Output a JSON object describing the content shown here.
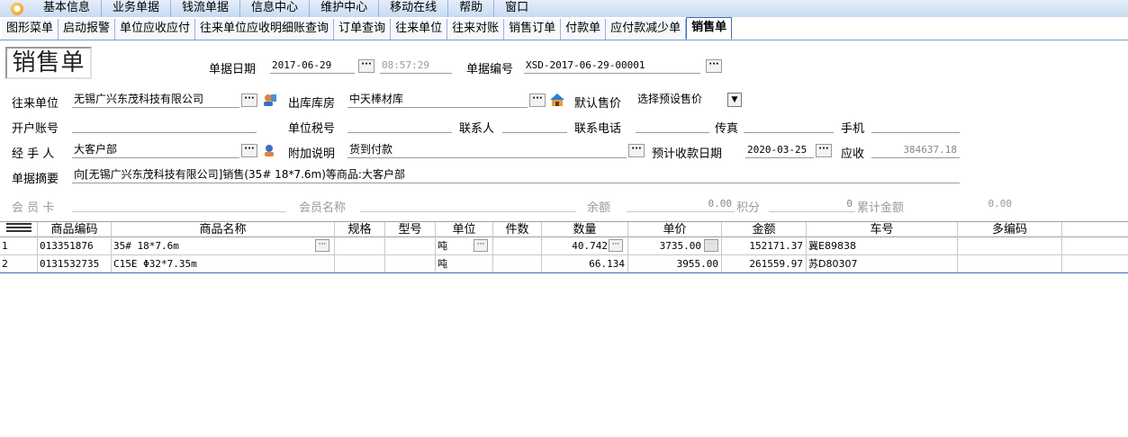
{
  "menubar": {
    "items": [
      "基本信息",
      "业务单据",
      "钱流单据",
      "信息中心",
      "维护中心",
      "移动在线",
      "帮助",
      "窗口"
    ]
  },
  "tabs": [
    "图形菜单",
    "启动报警",
    "单位应收应付",
    "往来单位应收明细账查询",
    "订单查询",
    "往来单位",
    "往来对账",
    "销售订单",
    "付款单",
    "应付款减少单",
    "销售单"
  ],
  "form": {
    "title": "销售单",
    "date_label": "单据日期",
    "date_value": "2017-06-29",
    "time_value": "08:57:29",
    "docno_label": "单据编号",
    "docno_value": "XSD-2017-06-29-00001",
    "partner_label": "往来单位",
    "partner_value": "无锡广兴东茂科技有限公司",
    "warehouse_label": "出库库房",
    "warehouse_value": "中天棒材库",
    "default_price_label": "默认售价",
    "default_price_value": "选择预设售价",
    "account_label": "开户账号",
    "account_value": "",
    "taxno_label": "单位税号",
    "taxno_value": "",
    "contact_label": "联系人",
    "contact_value": "",
    "phone_label": "联系电话",
    "phone_value": "",
    "fax_label": "传真",
    "fax_value": "",
    "mobile_label": "手机",
    "mobile_value": "",
    "handler_label": "经 手 人",
    "handler_value": "大客户部",
    "note_label": "附加说明",
    "note_value": "货到付款",
    "due_label": "预计收款日期",
    "due_value": "2020-03-25",
    "receivable_label": "应收",
    "receivable_value": "384637.18",
    "summary_label": "单据摘要",
    "summary_value": "向[无锡广兴东茂科技有限公司]销售(35# 18*7.6m)等商品:大客户部",
    "member_card_label": "会 员 卡",
    "member_name_label": "会员名称",
    "balance_label": "余额",
    "balance_value": "0.00",
    "points_label": "积分",
    "points_value": "0",
    "total_label": "累计金额",
    "total_value": "0.00"
  },
  "grid": {
    "headers": [
      "商品编码",
      "商品名称",
      "规格",
      "型号",
      "单位",
      "件数",
      "数量",
      "单价",
      "金额",
      "车号",
      "多编码"
    ],
    "rows": [
      {
        "no": "1",
        "code": "013351876",
        "name": "35# 18*7.6m",
        "spec": "",
        "model": "",
        "unit": "吨",
        "pieces": "",
        "qty": "40.742",
        "price": "3735.00",
        "amount": "152171.37",
        "plate": "冀E89838",
        "multi": ""
      },
      {
        "no": "2",
        "code": "0131532735",
        "name": "C15E Φ32*7.35m",
        "spec": "",
        "model": "",
        "unit": "吨",
        "pieces": "",
        "qty": "66.134",
        "price": "3955.00",
        "amount": "261559.97",
        "plate": "苏D80307",
        "multi": ""
      }
    ]
  },
  "colors": {
    "menubar_bg": "#c9daf2",
    "tab_active_border": "#3c6fb3"
  },
  "icons": [
    "app-logo-icon",
    "ellipsis-icon",
    "user-lookup-icon",
    "warehouse-icon",
    "dropdown-arrow-icon",
    "attach-note-icon",
    "grid-menu-icon"
  ]
}
